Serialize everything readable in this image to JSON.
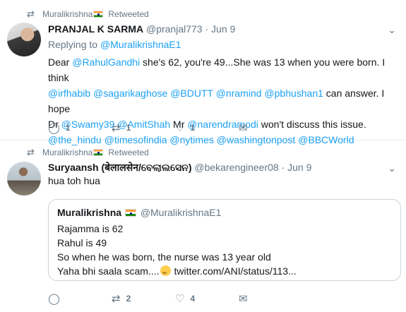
{
  "tweets": [
    {
      "retweeted_by": "Muralikrishna",
      "retweeted_suffix": "Retweeted",
      "author_name": "PRANJAL K SARMA",
      "author_handle": "@pranjal773",
      "separator": "·",
      "date": "Jun 9",
      "replying_to_label": "Replying to",
      "replying_to_handle": "@MuralikrishnaE1",
      "body_lines": [
        [
          "Dear ",
          "@RahulGandhi",
          " she's 62, you're 49...She was 13 when you were born. I think"
        ],
        [
          "@irfhabib",
          " ",
          "@sagarikaghose",
          " ",
          "@BDUTT",
          " ",
          "@nramind",
          " ",
          "@pbhushan1",
          " can answer. I hope"
        ],
        [
          "Dr ",
          "@Swamy39",
          " ",
          "@AmitShah",
          " Mr ",
          "@narendramodi",
          " won't discuss this issue."
        ],
        [
          "@the_hindu",
          " ",
          "@timesofindia",
          " ",
          "@nytimes",
          " ",
          "@washingtonpost",
          " ",
          "@BBCWorld"
        ]
      ],
      "actions": {
        "reply_count": "1",
        "retweet_count": "1",
        "like_count": "1"
      }
    },
    {
      "retweeted_by": "Muralikrishna",
      "retweeted_suffix": "Retweeted",
      "author_name": "Suryaansh (बेलालसेन/ବେଲାଲସେନ)",
      "author_handle": "@bekarengineer08",
      "separator": "·",
      "date": "Jun 9",
      "body": "hua toh hua",
      "quote": {
        "author_name": "Muralikrishna",
        "author_handle": "@MuralikrishnaE1",
        "lines": [
          "Rajamma is 62",
          "Rahul is 49",
          "So when he was born, the nurse was 13 year old",
          "Yaha bhi saala scam...."
        ],
        "link": "twitter.com/ANI/status/113..."
      },
      "actions": {
        "reply_count": "",
        "retweet_count": "2",
        "like_count": "4"
      }
    }
  ],
  "icons": {
    "retweet": "retweet-icon",
    "reply": "reply-icon",
    "like": "heart-icon",
    "dm": "envelope-icon",
    "more": "chevron-down-icon"
  },
  "colors": {
    "link": "#1da1f2",
    "muted": "#657786",
    "text": "#14171a"
  }
}
